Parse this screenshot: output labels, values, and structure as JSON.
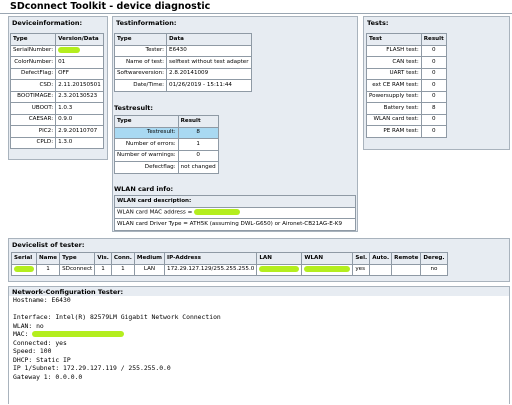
{
  "title": "SDconnect Toolkit - device diagnostic",
  "device_info": {
    "heading": "Deviceinformation:",
    "col_type": "Type",
    "col_value": "Version/Data",
    "rows": [
      {
        "label": "SerialNumber:",
        "value": "",
        "redacted": true
      },
      {
        "label": "ColorNumber:",
        "value": "01"
      },
      {
        "label": "DefectFlag:",
        "value": "OFF"
      },
      {
        "label": "CSD:",
        "value": "2.11.20150501"
      },
      {
        "label": "BOOTIMAGE:",
        "value": "2.3.20130523"
      },
      {
        "label": "UBOOT:",
        "value": "1.0.3"
      },
      {
        "label": "CAESAR:",
        "value": "0.9.0"
      },
      {
        "label": "PIC2:",
        "value": "2.9.20110707"
      },
      {
        "label": "CPLD:",
        "value": "1.3.0"
      }
    ]
  },
  "test_info": {
    "heading": "Testinformation:",
    "col_type": "Type",
    "col_data": "Data",
    "rows": [
      {
        "label": "Tester:",
        "value": "E6430"
      },
      {
        "label": "Name of test:",
        "value": "selftest without test adapter"
      },
      {
        "label": "Softwareversion:",
        "value": "2.8.20141009"
      },
      {
        "label": "Date/Time:",
        "value": "01/26/2019 - 15:11:44"
      }
    ]
  },
  "tests": {
    "heading": "Tests:",
    "col_test": "Test",
    "col_result": "Result",
    "rows": [
      {
        "label": "FLASH test:",
        "value": "0"
      },
      {
        "label": "CAN test:",
        "value": "0"
      },
      {
        "label": "UART test:",
        "value": "0"
      },
      {
        "label": "ext CE RAM test:",
        "value": "0"
      },
      {
        "label": "Powersupply test:",
        "value": "0"
      },
      {
        "label": "Battery test:",
        "value": "8"
      },
      {
        "label": "WLAN card test:",
        "value": "0"
      },
      {
        "label": "PE RAM test:",
        "value": "0"
      }
    ]
  },
  "test_result": {
    "heading": "Testresult:",
    "col_type": "Type",
    "col_result": "Result",
    "rows": [
      {
        "label": "Testresult:",
        "value": "8",
        "highlight": true
      },
      {
        "label": "Number of errors:",
        "value": "1"
      },
      {
        "label": "Number of warnings:",
        "value": "0"
      },
      {
        "label": "Defectflag:",
        "value": "not changed"
      }
    ]
  },
  "wlan": {
    "heading": "WLAN card info:",
    "description_header": "WLAN card description:",
    "mac_label": "WLAN card MAC address = ",
    "driver_line": "WLAN card Driver Type = ATH5K (assuming DWL-G650) or Aironet-CB21AG-E-K9"
  },
  "devicelist": {
    "heading": "Devicelist of tester:",
    "columns": [
      "Serial",
      "Name",
      "Type",
      "Vis.",
      "Conn.",
      "Medium",
      "IP-Address",
      "LAN",
      "WLAN",
      "Sel.",
      "Auto.",
      "Remote",
      "Dereg."
    ],
    "row": {
      "serial": "",
      "name": "1",
      "type": "SDconnect",
      "vis": "1",
      "conn": "1",
      "medium": "LAN",
      "ip": "172.29.127.129/255.255.255.0",
      "lan": "",
      "wlan": "",
      "sel": "yes",
      "auto": "",
      "remote": "",
      "dereg": "no"
    }
  },
  "network": {
    "heading": "Network-Configuration Tester:",
    "lines": [
      "Hostname: E6430",
      "",
      "Interface: Intel(R) 82579LM Gigabit Network Connection",
      "WLAN: no",
      "MAC: ",
      "Connected: yes",
      "Speed: 100",
      "DHCP: Static IP",
      "IP 1/Subnet: 172.29.127.119 / 255.255.0.0",
      "Gateway 1: 0.0.0.0"
    ]
  },
  "colors": {
    "panel_bg": "#e7ecf2",
    "highlight": "#a9d9f2",
    "redaction": "#b4ee1e"
  }
}
